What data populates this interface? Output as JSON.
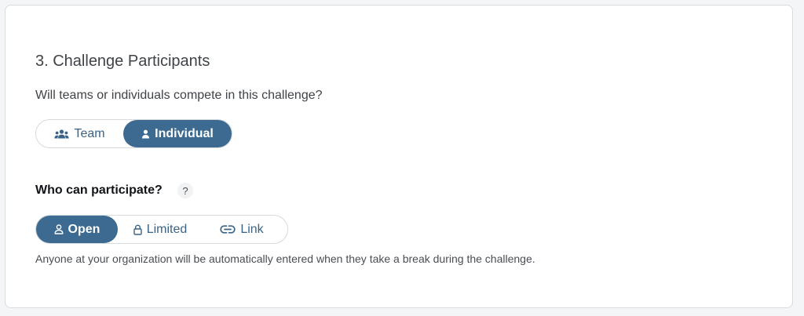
{
  "section": {
    "title": "3. Challenge Participants",
    "question": "Will teams or individuals compete in this challenge?"
  },
  "participant_type": {
    "options": [
      {
        "label": "Team",
        "icon": "people-group-icon",
        "selected": false
      },
      {
        "label": "Individual",
        "icon": "person-icon",
        "selected": true
      }
    ]
  },
  "who_can_participate": {
    "label": "Who can participate?",
    "help": "?",
    "options": [
      {
        "label": "Open",
        "icon": "user-outline-icon",
        "selected": true
      },
      {
        "label": "Limited",
        "icon": "lock-icon",
        "selected": false
      },
      {
        "label": "Link",
        "icon": "link-icon",
        "selected": false
      }
    ],
    "helper_text": "Anyone at your organization will be automatically entered when they take a break during the challenge."
  },
  "colors": {
    "accent": "#3c6a91",
    "accent_text": "#3a6388",
    "border": "#d7dadd",
    "background": "#f4f5f6"
  }
}
